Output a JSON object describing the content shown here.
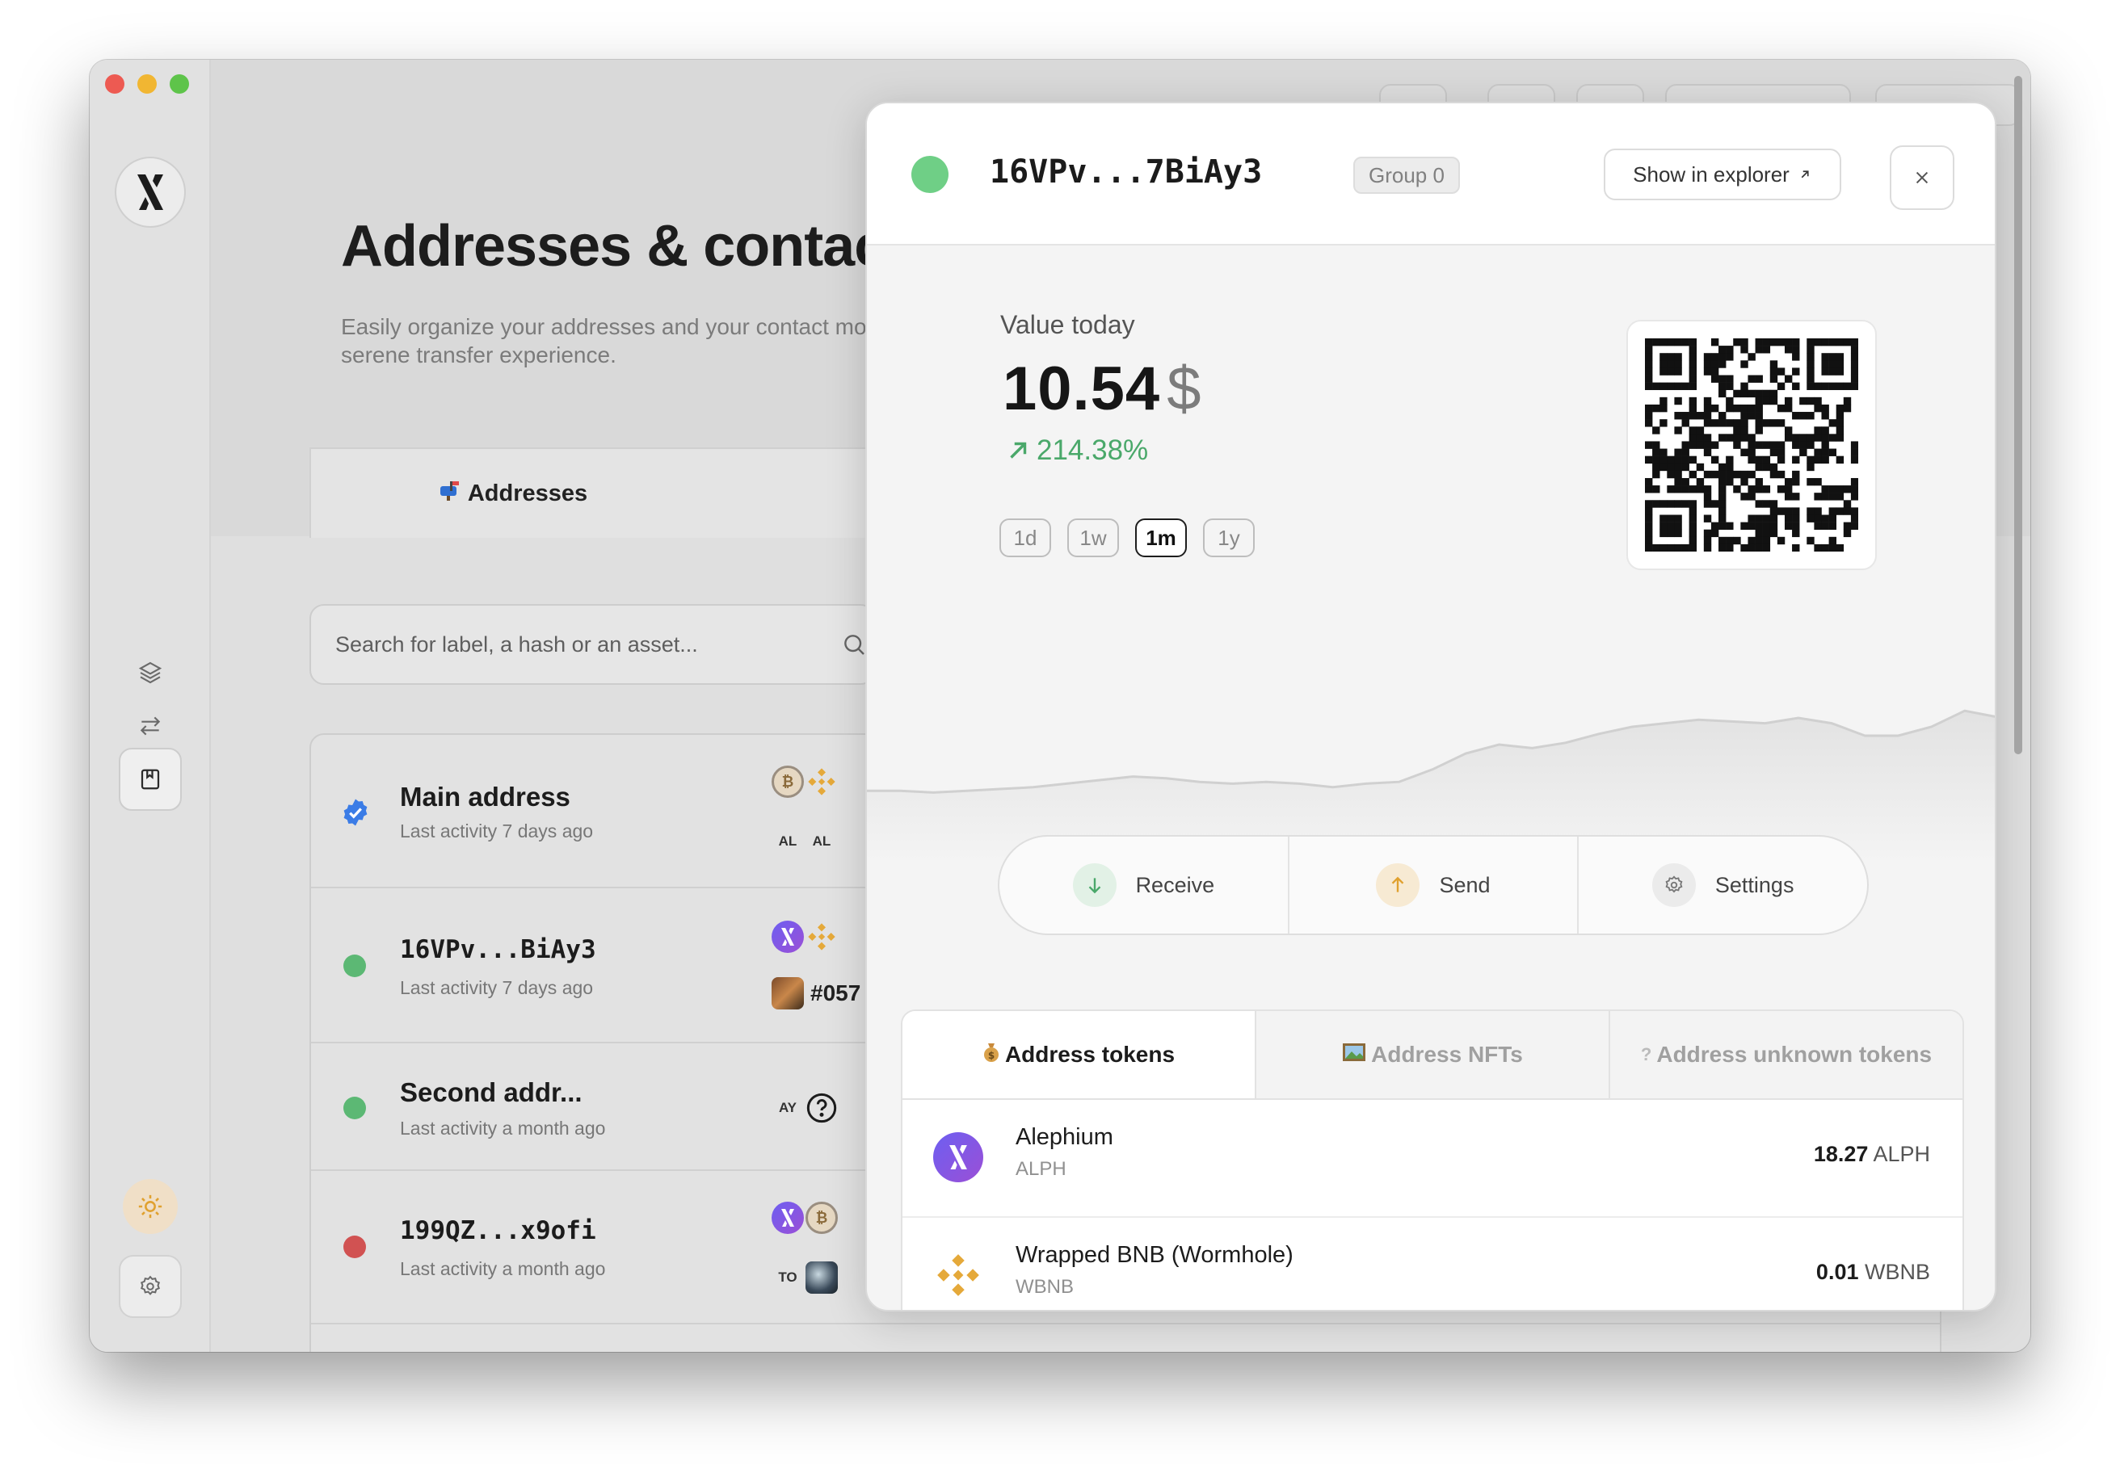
{
  "page": {
    "title": "Addresses & contac",
    "subtitle": "Easily organize your addresses and your contact more serene transfer experience.",
    "tab_addresses": "Addresses",
    "tab_addresses_icon": "mailbox-icon"
  },
  "search": {
    "placeholder": "Search for label, a hash or an asset..."
  },
  "addresses": [
    {
      "label": "Main address",
      "activity": "Last activity 7 days ago",
      "status_color": "#3b7ce6",
      "badge": "verified-check-icon",
      "assets": [
        "BTC",
        "BNB",
        "AL",
        "AL"
      ]
    },
    {
      "label": "16VPv...BiAy3",
      "activity": "Last activity 7 days ago",
      "status_color": "#5cb874",
      "assets": [
        "ALPH",
        "BNB"
      ],
      "nft": "#057"
    },
    {
      "label": "Second addr...",
      "activity": "Last activity a month ago",
      "status_color": "#5cb874",
      "assets": [
        "AY",
        "?"
      ]
    },
    {
      "label": "199QZ...x9ofi",
      "activity": "Last activity a month ago",
      "status_color": "#d15252",
      "assets": [
        "ALPH",
        "BTC",
        "TO"
      ]
    }
  ],
  "panel": {
    "hash": "16VPv...7BiAy3",
    "group": "Group 0",
    "explorer_label": "Show in explorer",
    "value_label": "Value today",
    "value": "10.54",
    "currency": "$",
    "change": "214.38%",
    "periods": [
      "1d",
      "1w",
      "1m",
      "1y"
    ],
    "active_period": "1m",
    "actions": {
      "receive": "Receive",
      "send": "Send",
      "settings": "Settings"
    },
    "token_tabs": [
      "Address tokens",
      "Address NFTs",
      "Address unknown tokens"
    ],
    "tokens": [
      {
        "name": "Alephium",
        "symbol": "ALPH",
        "amount": "18.27",
        "unit": "ALPH"
      },
      {
        "name": "Wrapped BNB (Wormhole)",
        "symbol": "WBNB",
        "amount": "0.01",
        "unit": "WBNB"
      }
    ]
  },
  "colors": {
    "accent_green": "#4aa86a",
    "alph_purple": "#7a58ea",
    "bnb_yellow": "#e5a93a"
  },
  "chart_data": {
    "type": "area",
    "title": "",
    "xlabel": "",
    "ylabel": "",
    "period": "1m",
    "values": [
      6.4,
      6.4,
      6.3,
      6.4,
      6.5,
      6.6,
      6.8,
      7.0,
      7.2,
      7.1,
      6.9,
      6.8,
      6.9,
      6.8,
      6.6,
      6.8,
      6.9,
      7.6,
      8.5,
      9.0,
      8.8,
      9.1,
      9.6,
      10.0,
      10.2,
      10.4,
      10.3,
      10.2,
      10.5,
      10.2,
      9.5,
      9.5,
      10.0,
      10.9,
      10.54
    ],
    "grid": false,
    "legend": "none"
  }
}
